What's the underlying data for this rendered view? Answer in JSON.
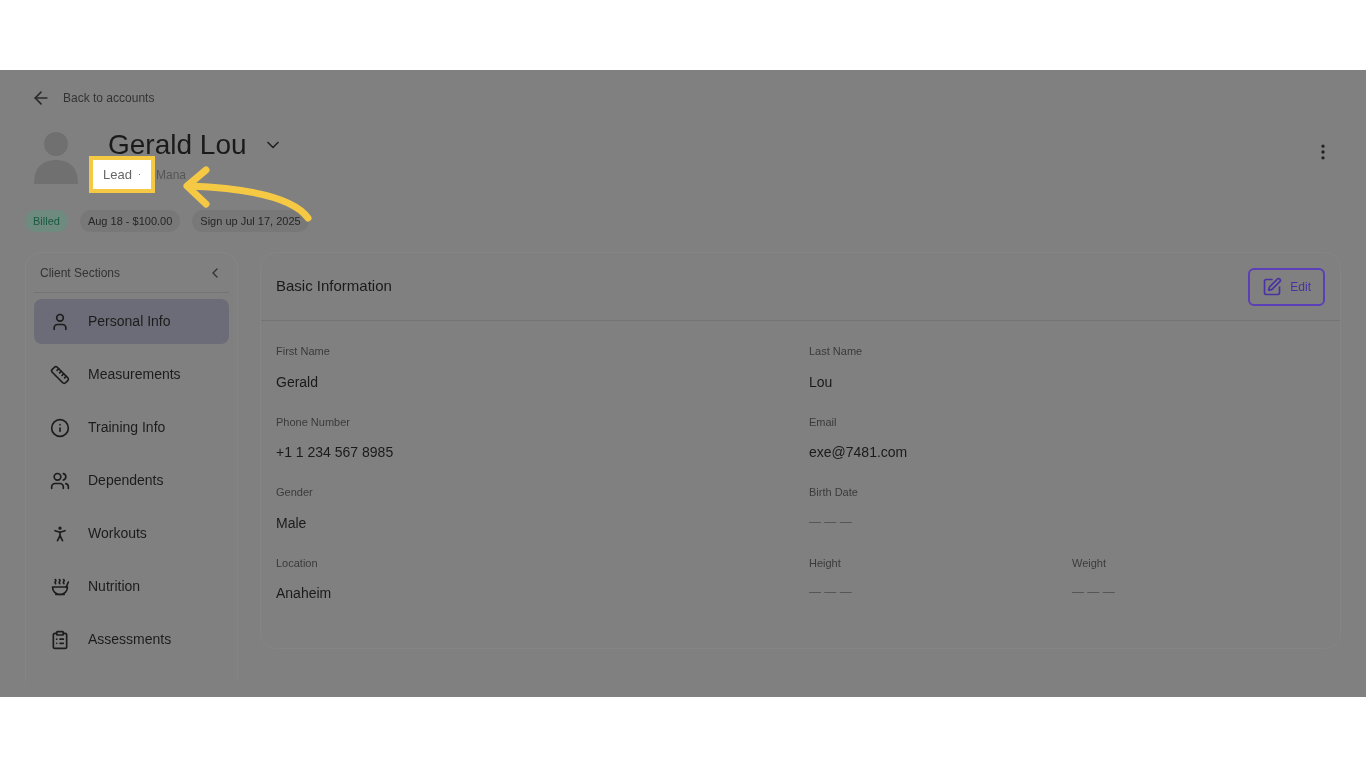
{
  "back_link": "Back to accounts",
  "client": {
    "name": "Gerald Lou",
    "status": "Lead",
    "separator": "·",
    "role": "Mana"
  },
  "pills": [
    {
      "label": "Billed",
      "kind": "status"
    },
    {
      "label": "Aug 18 - $100.00",
      "kind": "plain"
    },
    {
      "label": "Sign up Jul 17, 2025",
      "kind": "plain"
    }
  ],
  "sidebar": {
    "title": "Client Sections",
    "items": [
      {
        "label": "Personal Info",
        "selected": true
      },
      {
        "label": "Measurements",
        "selected": false
      },
      {
        "label": "Training Info",
        "selected": false
      },
      {
        "label": "Dependents",
        "selected": false
      },
      {
        "label": "Workouts",
        "selected": false
      },
      {
        "label": "Nutrition",
        "selected": false
      },
      {
        "label": "Assessments",
        "selected": false
      }
    ]
  },
  "basic_info": {
    "title": "Basic Information",
    "edit_button": "Edit",
    "rows": [
      [
        {
          "label": "First Name",
          "value": "Gerald",
          "kind": "filled"
        },
        {
          "label": "Last Name",
          "value": "Lou",
          "kind": "filled"
        }
      ],
      [
        {
          "label": "Phone Number",
          "value": "+1 1 234 567 8985",
          "kind": "filled"
        },
        {
          "label": "Email",
          "value": "exe@7481.com",
          "kind": "filled"
        }
      ],
      [
        {
          "label": "Gender",
          "value": "Male",
          "kind": "filled"
        },
        {
          "label": "Birth Date",
          "value": "— — —",
          "kind": "blank"
        }
      ],
      [
        {
          "label": "Location",
          "value": "Anaheim",
          "kind": "filled"
        },
        {
          "label": "Height",
          "value": "— — —",
          "kind": "blank"
        },
        {
          "label": "Weight",
          "value": "— — —",
          "kind": "blank"
        }
      ]
    ]
  }
}
